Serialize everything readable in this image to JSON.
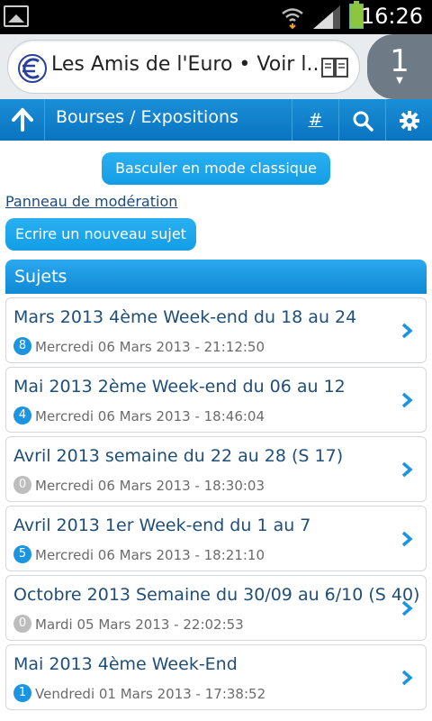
{
  "status": {
    "time": "16:26"
  },
  "browser": {
    "url_text": "Les Amis de l'Euro • Voir l...",
    "tab_count": "1"
  },
  "nav": {
    "title": "Bourses / Expositions",
    "hash_label": "#"
  },
  "actions": {
    "classic_mode": "Basculer en mode classique",
    "moderation": "Panneau de modération",
    "new_topic": "Ecrire un nouveau sujet"
  },
  "section": {
    "title": "Sujets"
  },
  "topics": [
    {
      "title": "Mars 2013 4ème Week-end du 18 au 24",
      "count": "8",
      "date": "Mercredi 06 Mars 2013 - 21:12:50"
    },
    {
      "title": "Mai 2013 2ème Week-end du 06 au 12",
      "count": "4",
      "date": "Mercredi 06 Mars 2013 - 18:46:04"
    },
    {
      "title": "Avril 2013 semaine du 22 au 28 (S 17)",
      "count": "0",
      "date": "Mercredi 06 Mars 2013 - 18:30:03"
    },
    {
      "title": "Avril 2013 1er Week-end du 1 au 7",
      "count": "5",
      "date": "Mercredi 06 Mars 2013 - 18:21:10"
    },
    {
      "title": "Octobre 2013 Semaine du 30/09 au 6/10 (S 40)",
      "count": "0",
      "date": "Mardi 05 Mars 2013 - 22:02:53"
    },
    {
      "title": "Mai 2013 4ème Week-End",
      "count": "1",
      "date": "Vendredi 01 Mars 2013 - 17:38:52"
    }
  ],
  "colors": {
    "accent": "#1a8fd6",
    "title_text": "#1f4e79",
    "badge_zero": "#bdbdbd"
  }
}
